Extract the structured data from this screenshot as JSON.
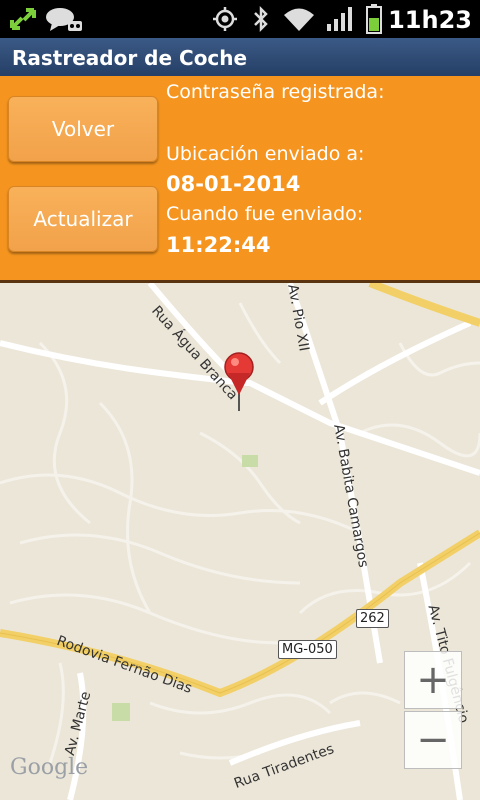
{
  "status_bar": {
    "time": "11h23",
    "icons": [
      "usb-sync-icon",
      "chat-icon",
      "voicemail-icon",
      "gps-icon",
      "bluetooth-icon",
      "wifi-icon",
      "signal-icon",
      "battery-icon"
    ]
  },
  "app": {
    "title": "Rastreador de Coche"
  },
  "panel": {
    "back_label": "Volver",
    "update_label": "Actualizar",
    "password_label": "Contraseña registrada:",
    "location_label": "Ubicación enviado a:",
    "date_value": "08-01-2014",
    "when_label": "Cuando fue enviado:",
    "time_value": "11:22:44"
  },
  "map": {
    "labels": {
      "agua_branca": "Rua Água Branca",
      "pio_xii": "Av. Pio XII",
      "babita": "Av. Babita Camargos",
      "fernao_dias": "Rodovia Fernão Dias",
      "tito": "Av. Tito Fulgêncio",
      "marte": "Av. Marte",
      "tiradentes": "Rua Tiradentes",
      "mg050": "MG-050",
      "r262": "262"
    },
    "zoom_in": "+",
    "zoom_out": "−",
    "attribution": "Google"
  },
  "colors": {
    "accent": "#f5951f",
    "titlebar": "#2e4a73",
    "marker": "#e53935"
  }
}
